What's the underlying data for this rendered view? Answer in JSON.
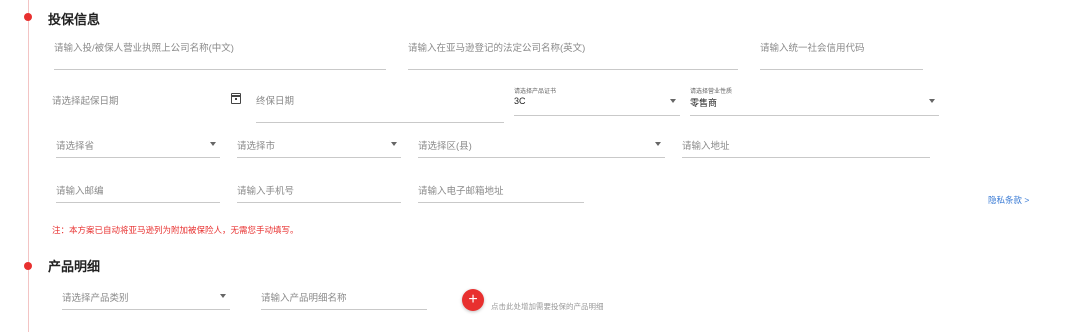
{
  "sections": {
    "insured": {
      "title": "投保信息"
    },
    "products": {
      "title": "产品明细"
    }
  },
  "fields": {
    "company_cn": {
      "placeholder": "请输入投/被保人营业执照上公司名称(中文)"
    },
    "company_en": {
      "placeholder": "请输入在亚马逊登记的法定公司名称(英文)"
    },
    "credit_code": {
      "placeholder": "请输入统一社会信用代码"
    },
    "start_date": {
      "placeholder": "请选择起保日期"
    },
    "end_date": {
      "placeholder": "终保日期"
    },
    "cert": {
      "label": "请选择产品证书",
      "value": "3C"
    },
    "nature": {
      "label": "请选择营业性质",
      "value": "零售商"
    },
    "province": {
      "placeholder": "请选择省"
    },
    "city": {
      "placeholder": "请选择市"
    },
    "district": {
      "placeholder": "请选择区(县)"
    },
    "address": {
      "placeholder": "请输入地址"
    },
    "postcode": {
      "placeholder": "请输入邮编"
    },
    "phone": {
      "placeholder": "请输入手机号"
    },
    "email": {
      "placeholder": "请输入电子邮箱地址"
    },
    "category": {
      "placeholder": "请选择产品类别"
    },
    "product_name": {
      "placeholder": "请输入产品明细名称"
    }
  },
  "privacy_link": "隐私条款 >",
  "note": "注：本方案已自动将亚马逊列为附加被保险人，无需您手动填写。",
  "add_button": {
    "icon": "+",
    "hint": "点击此处增加需要投保的产品明细"
  },
  "colors": {
    "accent": "#e8302f",
    "link": "#3a7bd5"
  }
}
